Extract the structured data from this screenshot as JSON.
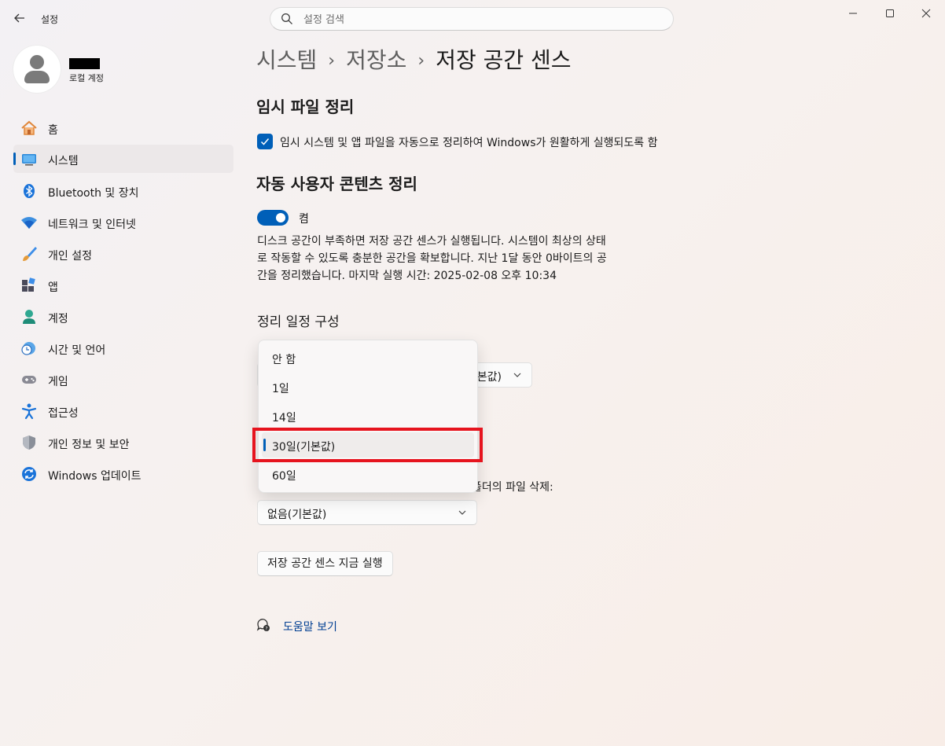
{
  "window": {
    "title": "설정"
  },
  "search": {
    "placeholder": "설정 검색"
  },
  "profile": {
    "account_type": "로컬 계정"
  },
  "nav": {
    "items": [
      {
        "label": "홈",
        "icon": "home-icon"
      },
      {
        "label": "시스템",
        "icon": "system-icon",
        "selected": true
      },
      {
        "label": "Bluetooth 및 장치",
        "icon": "bluetooth-icon"
      },
      {
        "label": "네트워크 및 인터넷",
        "icon": "wifi-icon"
      },
      {
        "label": "개인 설정",
        "icon": "brush-icon"
      },
      {
        "label": "앱",
        "icon": "apps-icon"
      },
      {
        "label": "계정",
        "icon": "account-icon"
      },
      {
        "label": "시간 및 언어",
        "icon": "time-language-icon"
      },
      {
        "label": "게임",
        "icon": "gamepad-icon"
      },
      {
        "label": "접근성",
        "icon": "accessibility-icon"
      },
      {
        "label": "개인 정보 및 보안",
        "icon": "shield-icon"
      },
      {
        "label": "Windows 업데이트",
        "icon": "update-icon"
      }
    ]
  },
  "breadcrumb": {
    "level1": "시스템",
    "level2": "저장소",
    "current": "저장 공간 센스",
    "separator": "›"
  },
  "temp_cleanup": {
    "heading": "임시 파일 정리",
    "checkbox_label": "임시 시스템 및 앱 파일을 자동으로 정리하여 Windows가 원활하게 실행되도록 함",
    "checked": true
  },
  "auto_cleanup": {
    "heading": "자동 사용자 콘텐츠 정리",
    "toggle_label": "켬",
    "toggle_on": true,
    "description": "디스크 공간이 부족하면 저장 공간 센스가 실행됩니다. 시스템이 최상의 상태로 작동할 수 있도록 충분한 공간을 확보합니다. 지난 1달 동안 0바이트의 공간을 정리했습니다. 마지막 실행 시간: 2025-02-08 오후 10:34"
  },
  "schedule": {
    "heading": "정리 일정 구성",
    "hidden_select_text": "본값)",
    "partial_label": "폴더의 파일 삭제:",
    "downloads_select_value": "없음(기본값)",
    "run_now_button": "저장 공간 센스 지금 실행"
  },
  "dropdown": {
    "options": [
      "안 함",
      "1일",
      "14일",
      "30일(기본값)",
      "60일"
    ],
    "selected_index": 3
  },
  "help": {
    "link": "도움말 보기"
  },
  "colors": {
    "accent": "#005fb8",
    "highlight": "#e6141e",
    "link": "#003e92"
  }
}
